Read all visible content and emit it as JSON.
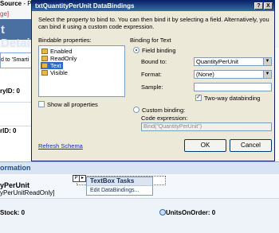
{
  "background": {
    "source_label": "Source",
    "source_suffix": " - Proc",
    "page_tag": "ge]",
    "header_text": "t Detai",
    "bound_to_text": "d to 'Smarti",
    "field_1": "ryID: 0",
    "field_2": "rID: 0",
    "section_title": "ormation",
    "field_name": "yPerUnit",
    "field_readonly": "yPerUnitReadOnly]",
    "tasks_title": "TextBox Tasks",
    "tasks_link": "Edit DataBindings...",
    "units_in_stock": "Stock: 0",
    "units_on_order": "UnitsOnOrder: 0"
  },
  "dialog": {
    "title": "txtQuantityPerUnit DataBindings",
    "help_btn": "?",
    "close_btn": "X",
    "description": "Select the property to bind to. You can then bind it by selecting a field. Alternatively, you can bind it using a custom code expression.",
    "bindable_label": "Bindable properties:",
    "properties": [
      {
        "label": "Enabled",
        "selected": false
      },
      {
        "label": "ReadOnly",
        "selected": false
      },
      {
        "label": "Text",
        "selected": true
      },
      {
        "label": "Visible",
        "selected": false
      }
    ],
    "show_all_label": "Show all properties",
    "binding_for": "Binding for Text",
    "field_binding_label": "Field binding",
    "bound_to_label": "Bound to:",
    "bound_to_value": "QuantityPerUnit",
    "format_label": "Format:",
    "format_value": "(None)",
    "sample_label": "Sample:",
    "two_way_label": "Two-way databinding",
    "custom_binding_label": "Custom binding:",
    "code_expression_label": "Code expression:",
    "code_expression_value": "Bind(\"QuantityPerUnit\")",
    "refresh_link": "Refresh Schema",
    "ok_label": "OK",
    "cancel_label": "Cancel"
  }
}
